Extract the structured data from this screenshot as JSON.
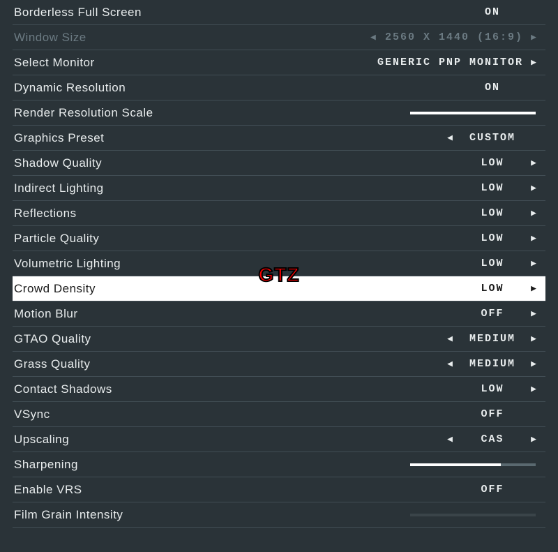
{
  "watermark": "GTZ",
  "settings": [
    {
      "label": "Borderless Full Screen",
      "value": "ON",
      "left": false,
      "right": false,
      "type": "text",
      "state": "normal"
    },
    {
      "label": "Window Size",
      "value": "2560 X 1440 (16:9)",
      "left": true,
      "right": true,
      "type": "text-wide",
      "state": "disabled"
    },
    {
      "label": "Select Monitor",
      "value": "GENERIC PNP MONITOR",
      "left": false,
      "right": true,
      "type": "text-wide",
      "state": "normal"
    },
    {
      "label": "Dynamic Resolution",
      "value": "ON",
      "left": false,
      "right": false,
      "type": "text",
      "state": "normal"
    },
    {
      "label": "Render Resolution Scale",
      "value": "",
      "left": false,
      "right": false,
      "type": "slider",
      "fill": 100,
      "state": "normal"
    },
    {
      "label": "Graphics Preset",
      "value": "CUSTOM",
      "left": true,
      "right": false,
      "type": "text",
      "state": "normal"
    },
    {
      "label": "Shadow Quality",
      "value": "LOW",
      "left": false,
      "right": true,
      "type": "text",
      "state": "normal"
    },
    {
      "label": "Indirect Lighting",
      "value": "LOW",
      "left": false,
      "right": true,
      "type": "text",
      "state": "normal"
    },
    {
      "label": "Reflections",
      "value": "LOW",
      "left": false,
      "right": true,
      "type": "text",
      "state": "normal"
    },
    {
      "label": "Particle Quality",
      "value": "LOW",
      "left": false,
      "right": true,
      "type": "text",
      "state": "normal"
    },
    {
      "label": "Volumetric Lighting",
      "value": "LOW",
      "left": false,
      "right": true,
      "type": "text",
      "state": "normal"
    },
    {
      "label": "Crowd Density",
      "value": "LOW",
      "left": false,
      "right": true,
      "type": "text",
      "state": "selected"
    },
    {
      "label": "Motion Blur",
      "value": "OFF",
      "left": false,
      "right": true,
      "type": "text",
      "state": "normal"
    },
    {
      "label": "GTAO Quality",
      "value": "MEDIUM",
      "left": true,
      "right": true,
      "type": "text",
      "state": "normal"
    },
    {
      "label": "Grass Quality",
      "value": "MEDIUM",
      "left": true,
      "right": true,
      "type": "text",
      "state": "normal"
    },
    {
      "label": "Contact Shadows",
      "value": "LOW",
      "left": false,
      "right": true,
      "type": "text",
      "state": "normal"
    },
    {
      "label": "VSync",
      "value": "OFF",
      "left": false,
      "right": false,
      "type": "text",
      "state": "normal"
    },
    {
      "label": "Upscaling",
      "value": "CAS",
      "left": true,
      "right": true,
      "type": "text",
      "state": "normal"
    },
    {
      "label": "Sharpening",
      "value": "",
      "left": false,
      "right": false,
      "type": "slider",
      "fill": 72,
      "state": "normal"
    },
    {
      "label": "Enable VRS",
      "value": "OFF",
      "left": false,
      "right": false,
      "type": "text",
      "state": "normal"
    },
    {
      "label": "Film Grain Intensity",
      "value": "",
      "left": false,
      "right": false,
      "type": "slider-empty",
      "fill": 0,
      "state": "normal"
    }
  ]
}
